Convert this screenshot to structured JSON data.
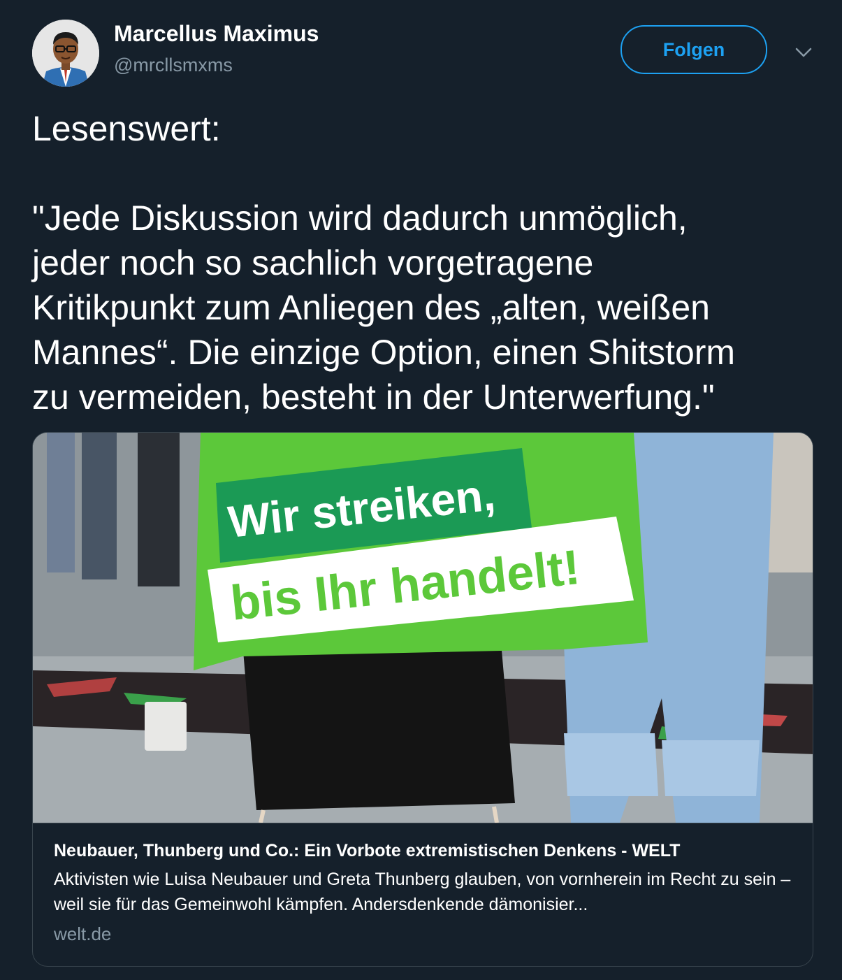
{
  "author": {
    "display_name": "Marcellus Maximus",
    "handle": "@mrcllsmxms"
  },
  "follow_label": "Folgen",
  "tweet": {
    "lines": [
      "Lesenswert:",
      "",
      "\"Jede Diskussion wird dadurch unmöglich,",
      "jeder noch so sachlich vorgetragene",
      "Kritikpunkt zum Anliegen des „alten, weißen",
      "Mannes“. Die einzige Option, einen Shitstorm",
      "zu vermeiden, besteht in der Unterwerfung.\""
    ]
  },
  "card": {
    "image": {
      "banner_line1": "Wir streiken,",
      "banner_line2": "bis Ihr handelt!",
      "colors": {
        "banner_green": "#5cc83a",
        "banner_dark": "#1b9a55",
        "banner_light_text": "#5cc83a"
      }
    },
    "title": "Neubauer, Thunberg und Co.: Ein Vorbote extremistischen Denkens - WELT",
    "description": "Aktivisten wie Luisa Neubauer und Greta Thunberg glauben, von vornherein im Recht zu sein – weil sie für das Gemeinwohl kämpfen. Andersdenkende dämonisier...",
    "domain": "welt.de"
  },
  "colors": {
    "background": "#15202b",
    "accent": "#1da1f2",
    "secondary_text": "#8899a6",
    "border": "#38444d"
  },
  "icons": {
    "caret": "chevron-down-icon"
  }
}
